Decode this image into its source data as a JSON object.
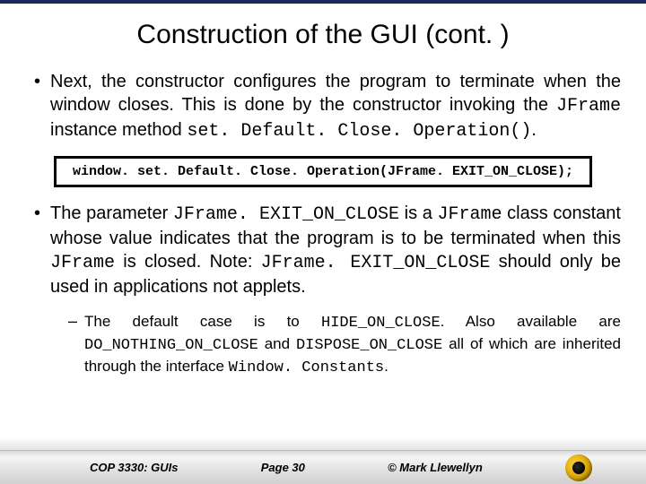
{
  "title": "Construction of the GUI (cont. )",
  "bullets": [
    {
      "pre": "Next, the constructor configures the program to terminate when the window closes.  This is done by the constructor invoking the ",
      "code1": "JFrame",
      "mid": " instance method ",
      "code2": "set. Default. Close. Operation()",
      "post": "."
    },
    {
      "pre": "The parameter ",
      "code1": "JFrame. EXIT_ON_CLOSE",
      "mid1": " is a ",
      "code2": "JFrame",
      "mid2": " class constant whose value indicates that the program is to be terminated when this ",
      "code3": "JFrame",
      "mid3": " is closed.   Note: ",
      "code4": "JFrame. EXIT_ON_CLOSE",
      "post": " should only be used in applications not applets."
    }
  ],
  "codebox": "window. set. Default. Close. Operation(JFrame. EXIT_ON_CLOSE);",
  "sub": {
    "pre": "The default case is to ",
    "code1": "HIDE_ON_CLOSE",
    "mid1": ".  Also available are ",
    "code2": "DO_NOTHING_ON_CLOSE",
    "mid2": " and ",
    "code3": "DISPOSE_ON_CLOSE",
    "mid3": " all of which are inherited through the interface ",
    "code4": "Window. Constants",
    "post": "."
  },
  "footer": {
    "course": "COP 3330:  GUIs",
    "page": "Page 30",
    "copyright": "© Mark Llewellyn"
  }
}
